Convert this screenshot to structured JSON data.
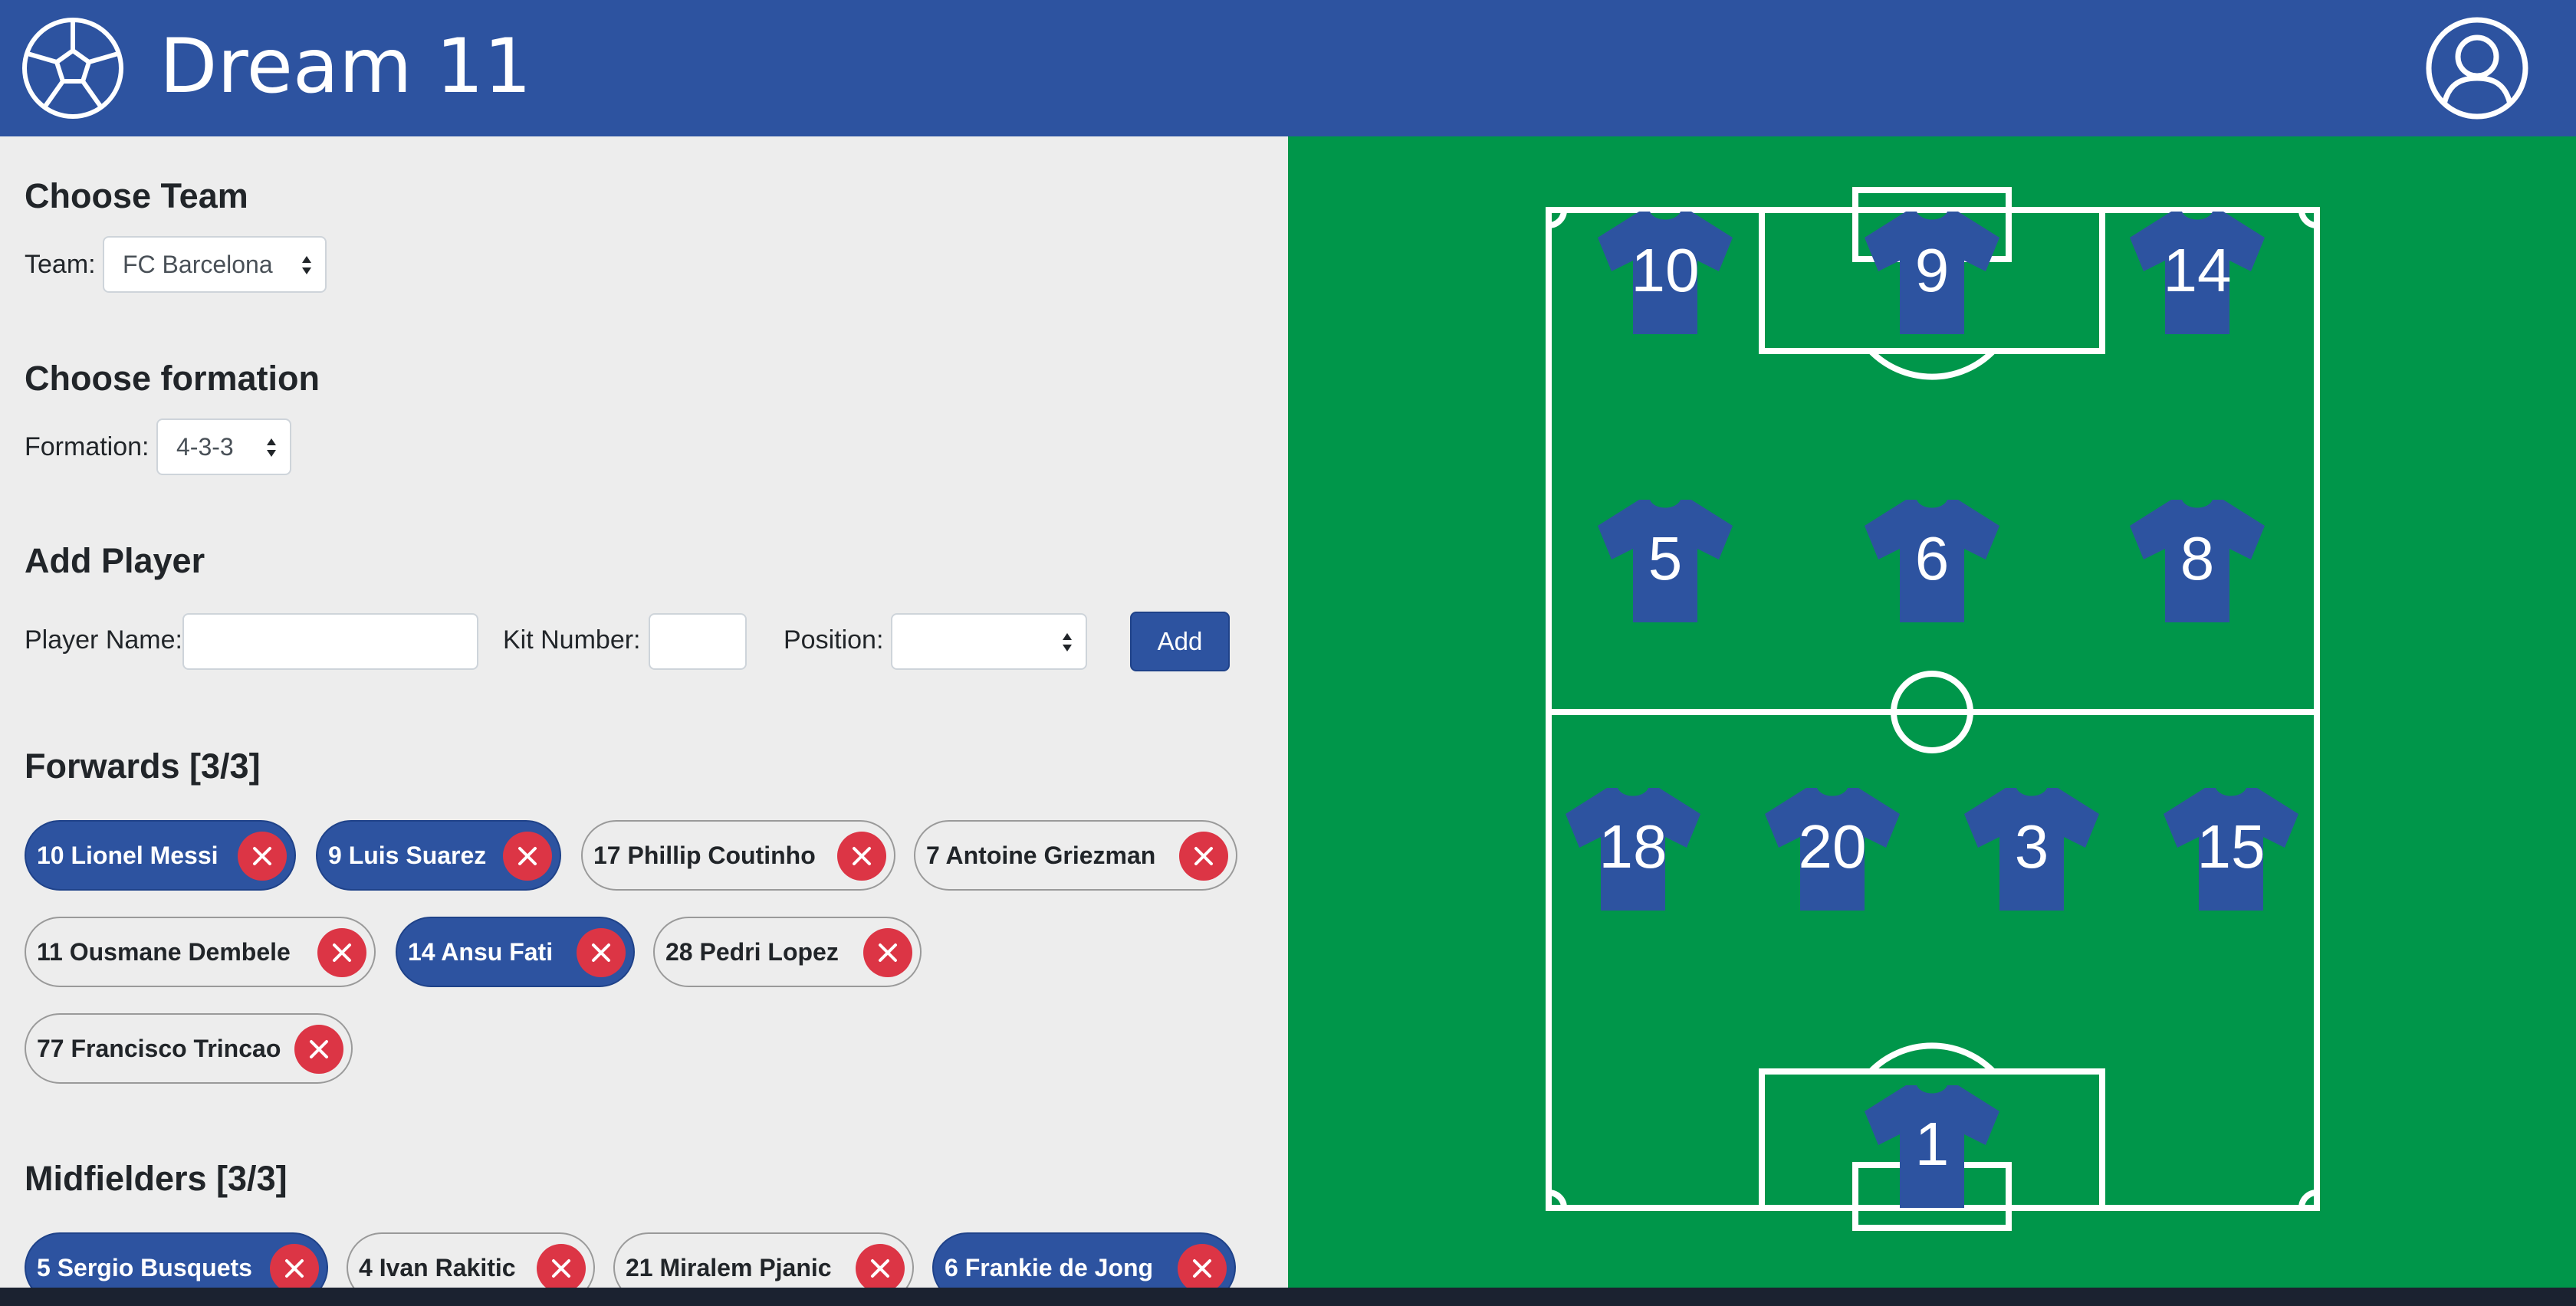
{
  "header": {
    "title": "Dream 11",
    "logo_icon": "soccer-ball-icon",
    "user_icon": "user-circle-icon"
  },
  "choose_team": {
    "title": "Choose Team",
    "label": "Team:",
    "value": "FC Barcelona"
  },
  "choose_formation": {
    "title": "Choose formation",
    "label": "Formation:",
    "value": "4-3-3"
  },
  "add_player": {
    "title": "Add Player",
    "name_label": "Player Name:",
    "name_value": "",
    "kit_label": "Kit Number:",
    "kit_value": "",
    "position_label": "Position:",
    "position_value": "",
    "add_label": "Add"
  },
  "forwards": {
    "title": "Forwards [3/3]",
    "players": [
      {
        "label": "10 Lionel Messi",
        "selected": true
      },
      {
        "label": "9 Luis Suarez",
        "selected": true
      },
      {
        "label": "17 Phillip Coutinho",
        "selected": false
      },
      {
        "label": "7 Antoine Griezman",
        "selected": false
      },
      {
        "label": "11 Ousmane Dembele",
        "selected": false
      },
      {
        "label": "14 Ansu Fati",
        "selected": true
      },
      {
        "label": "28 Pedri Lopez",
        "selected": false
      },
      {
        "label": "77 Francisco Trincao",
        "selected": false
      }
    ]
  },
  "midfielders": {
    "title": "Midfielders [3/3]",
    "players": [
      {
        "label": "5 Sergio Busquets",
        "selected": true
      },
      {
        "label": "4 Ivan Rakitic",
        "selected": false
      },
      {
        "label": "21 Miralem Pjanic",
        "selected": false
      },
      {
        "label": "6 Frankie de Jong",
        "selected": true
      }
    ]
  },
  "pitch": {
    "forward_numbers": [
      "10",
      "9",
      "14"
    ],
    "midfield_numbers": [
      "5",
      "6",
      "8"
    ],
    "defender_numbers": [
      "18",
      "20",
      "3",
      "15"
    ],
    "goalkeeper_number": "1"
  },
  "colors": {
    "brand": "#2d53a0",
    "pitch": "#00964a",
    "remove": "#dc3545"
  }
}
